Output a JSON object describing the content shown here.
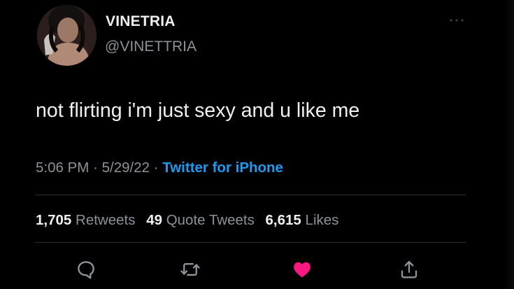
{
  "user": {
    "display_name": "VINETRIA",
    "handle": "@VINETTRIA"
  },
  "tweet": {
    "text": "not flirting i'm just sexy and u like me",
    "time": "5:06 PM",
    "date": "5/29/22",
    "source": "Twitter for iPhone",
    "separator": "·"
  },
  "stats": {
    "retweets_count": "1,705",
    "retweets_label": "Retweets",
    "quotes_count": "49",
    "quotes_label": "Quote Tweets",
    "likes_count": "6,615",
    "likes_label": "Likes"
  },
  "actions": {
    "reply_icon": "reply-icon",
    "retweet_icon": "retweet-icon",
    "like_icon": "heart-icon",
    "share_icon": "share-icon",
    "liked": true
  },
  "colors": {
    "background": "#000000",
    "text_primary": "#eef0f1",
    "text_secondary": "#8b9299",
    "link": "#1d9bf0",
    "like": "#f91880"
  }
}
